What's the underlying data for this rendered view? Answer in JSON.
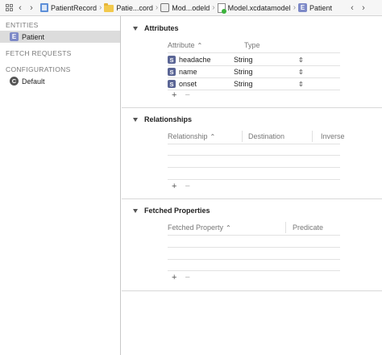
{
  "jumpbar": {
    "crumbs": [
      {
        "label": "PatientRecord",
        "icon": "project-icon"
      },
      {
        "label": "Patie...cord",
        "icon": "folder-icon"
      },
      {
        "label": "Mod...odeld",
        "icon": "model-bundle-icon"
      },
      {
        "label": "Model.xcdatamodel",
        "icon": "xcdatamodel-icon"
      },
      {
        "label": "Patient",
        "icon": "entity-icon",
        "badge": "E"
      }
    ]
  },
  "sidebar": {
    "entities_header": "ENTITIES",
    "entities": [
      {
        "label": "Patient",
        "badge": "E"
      }
    ],
    "fetch_header": "FETCH REQUESTS",
    "configurations_header": "CONFIGURATIONS",
    "configurations": [
      {
        "label": "Default",
        "badge": "C"
      }
    ]
  },
  "attributes": {
    "title": "Attributes",
    "col_attribute": "Attribute",
    "col_type": "Type",
    "rows": [
      {
        "badge": "S",
        "name": "headache",
        "type": "String"
      },
      {
        "badge": "S",
        "name": "name",
        "type": "String"
      },
      {
        "badge": "S",
        "name": "onset",
        "type": "String"
      }
    ],
    "plus": "+",
    "minus": "−"
  },
  "relationships": {
    "title": "Relationships",
    "col_relationship": "Relationship",
    "col_destination": "Destination",
    "col_inverse": "Inverse",
    "plus": "+",
    "minus": "−"
  },
  "fetched": {
    "title": "Fetched Properties",
    "col_fetched": "Fetched Property",
    "col_predicate": "Predicate",
    "plus": "+",
    "minus": "−"
  },
  "glyphs": {
    "back": "‹",
    "forward": "›",
    "sort_up": "⌃",
    "stepper": "⇕",
    "chevron_sep": "〉"
  }
}
